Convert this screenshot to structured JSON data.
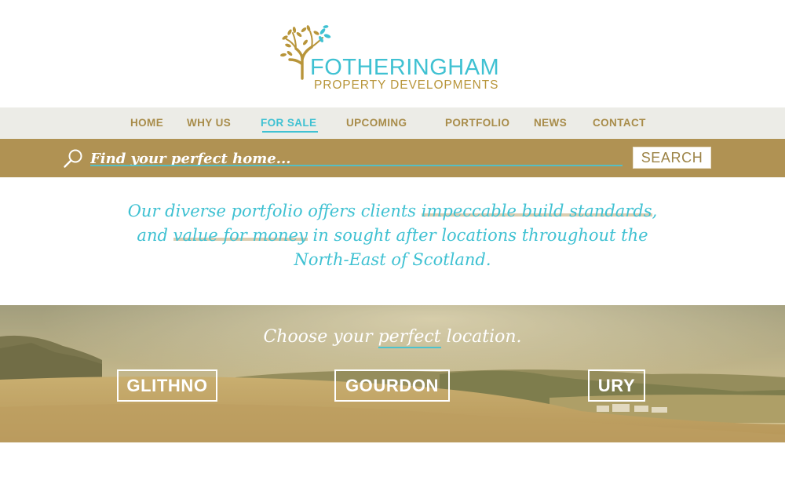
{
  "brand": {
    "title": "FOTHERINGHAM",
    "subtitle": "PROPERTY DEVELOPMENTS",
    "colors": {
      "teal": "#3fc1d2",
      "gold": "#b09253",
      "nav_bg": "#ecece7"
    }
  },
  "nav": {
    "items": [
      {
        "label": "HOME",
        "active": false
      },
      {
        "label": "WHY US",
        "active": false
      },
      {
        "label": "FOR SALE",
        "active": true
      },
      {
        "label": "UPCOMING",
        "active": false
      },
      {
        "label": "PORTFOLIO",
        "active": false
      },
      {
        "label": "NEWS",
        "active": false
      },
      {
        "label": "CONTACT",
        "active": false
      }
    ]
  },
  "search": {
    "placeholder": "Find your perfect home...",
    "button_label": "SEARCH",
    "icon": "search-icon"
  },
  "tagline": {
    "part1": "Our diverse portfolio offers clients ",
    "highlight1": "impeccable build standards",
    "part2": ", and ",
    "highlight2": "value for money",
    "part3": " in sought after locations throughout the North-East of Scotland."
  },
  "locations": {
    "heading_pre": "Choose your ",
    "heading_em": "perfect",
    "heading_post": " location.",
    "items": [
      {
        "label": "GLITHNO"
      },
      {
        "label": "GOURDON"
      },
      {
        "label": "URY"
      }
    ]
  }
}
